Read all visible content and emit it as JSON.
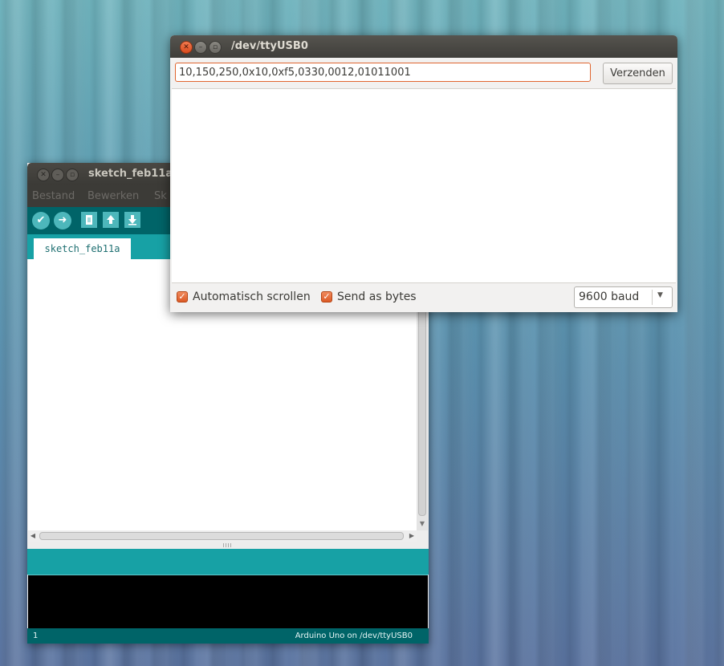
{
  "ide": {
    "title": "sketch_feb11a",
    "menu": [
      "Bestand",
      "Bewerken",
      "Sk"
    ],
    "toolbar": {
      "verify_icon": "✔",
      "upload_icon": "➜",
      "new_icon": "new-file-icon",
      "open_icon": "open-icon",
      "save_icon": "save-icon"
    },
    "tab_label": "sketch_feb11a",
    "footer": {
      "line": "1",
      "board": "Arduino Uno on /dev/ttyUSB0"
    },
    "colors": {
      "toolbar": "#006468",
      "tabbar": "#17a1a5",
      "console": "#000000"
    }
  },
  "serial": {
    "title": "/dev/ttyUSB0",
    "input_value": "10,150,250,0x10,0xf5,0330,0012,01011001",
    "send_label": "Verzenden",
    "autoscroll_label": "Automatisch scrollen",
    "send_bytes_label": "Send as bytes",
    "baud_value": "9600 baud",
    "colors": {
      "accent": "#dd4814",
      "checkbox": "#e0652f"
    }
  }
}
